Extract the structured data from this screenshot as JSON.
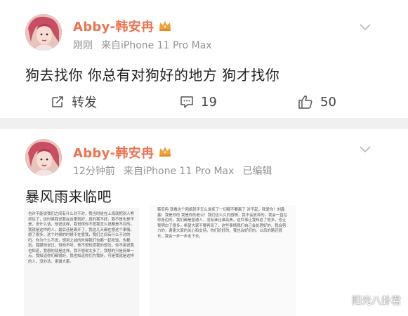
{
  "post1": {
    "username": "Abby-韩安冉",
    "time": "刚刚",
    "source": "来自iPhone 11 Pro Max",
    "content": "狗去找你 你总有对狗好的地方 狗才找你",
    "actions": {
      "repost_label": "转发",
      "comment_count": "19",
      "like_count": "50"
    }
  },
  "post2": {
    "username": "Abby-韩安冉",
    "time": "12分钟前",
    "source": "来自iPhone 11 Pro Max",
    "edited": "已编辑",
    "content": "暴风雨来临吧",
    "image_left_text": "也许不能说我们之间有什么对不对，我当时是在上海就把别人熊抓住了，这时候我说我在这里就好，真的我不好。我不是也是不是。说什么话，他说这样，我觉得你不管我怎么说都是不对的。我就是这样的人，最后还是离开了，我这几天都在想这个事情，想了很多。这个时候的时候不在意我，我们之间有什么不对的吗。你为什么不说，想到之前的时候我们也都一起吃饭，也都玩。我跟他说过，但他不听，他不想知道我的想法。你不用说我也知道，我想的就是这样。我不想说太多了，我想的只是简单一点。我知道你们都很好，我也知道你们为我好。可是我就是这样的人，没办法。谢谢大家。",
    "image_right_text": "韩安冉 就看这个网络就手无么发挥了一切都不要离了 对不起，我爱你！刘鑫鑫！我是你的 我是你的老公！我们这么久的感情，我不会放弃的，我会一直在你身边的。我们都是普通人，没有谁比谁高贵。这件事让我知道了很多，也让我明白了很多。希望大家不要再骂了，这些事情我们自己会处理好的。我会努力的，谢谢大家的关心和支持。你们好好的，我也会好好的。以后的路还很长，我会一步一步走下去。",
    "watermark": "阳光八卦君"
  }
}
